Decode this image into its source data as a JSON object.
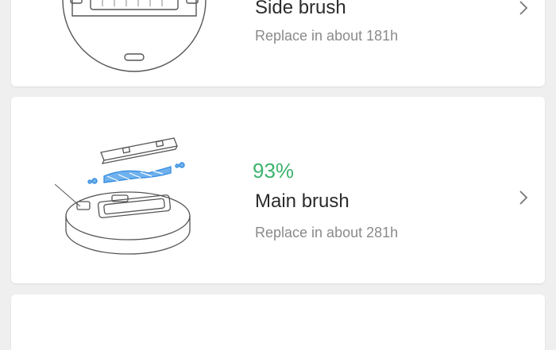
{
  "items": [
    {
      "percent": "",
      "name": "Side brush",
      "replace_text": "Replace in about 181h",
      "icon": "robot-underside-icon"
    },
    {
      "percent": "93%",
      "name": "Main brush",
      "replace_text": "Replace in about 281h",
      "icon": "main-brush-icon"
    },
    {
      "percent": "",
      "name": "",
      "replace_text": ""
    }
  ],
  "colors": {
    "percent_good": "#3cb46e",
    "background": "#efefef",
    "card": "#ffffff",
    "brush_accent": "#3b8fe0"
  }
}
